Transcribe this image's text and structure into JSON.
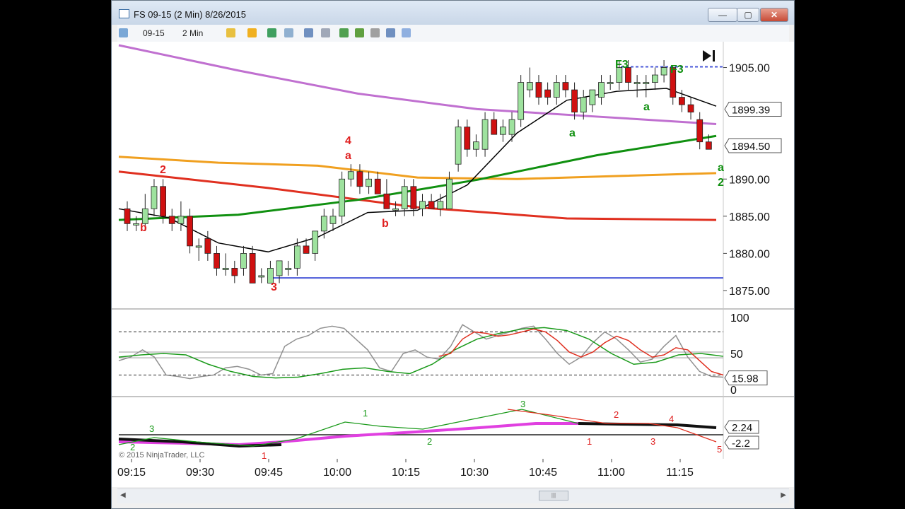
{
  "window": {
    "title": "FS 09-15 (2 Min)  8/26/2015",
    "buttons": {
      "minimize": "—",
      "maximize": "▢",
      "close": "✕"
    }
  },
  "toolbar": {
    "instrument": "09-15",
    "interval": "2 Min"
  },
  "icons": [
    "chart-app-icon",
    "bar-style-icon",
    "pencil-icon",
    "pen-tool-icon",
    "crosshair-icon",
    "zoom-icon",
    "properties-icon",
    "data-box-icon",
    "strategy-icon",
    "indicators-icon",
    "save-icon",
    "copy-icon"
  ],
  "copyright": "© 2015 NinjaTrader, LLC",
  "chart_data": {
    "type": "candlestick",
    "x_labels": [
      "09:15",
      "09:30",
      "09:45",
      "10:00",
      "10:15",
      "10:30",
      "10:45",
      "11:00",
      "11:15"
    ],
    "price_ticks": [
      "1905.00",
      "1890.00",
      "1885.00",
      "1880.00",
      "1875.00"
    ],
    "price_badges": [
      "1899.39",
      "1894.50"
    ],
    "ylim": [
      1873,
      1908
    ],
    "candles": [
      {
        "o": 1886,
        "h": 1887,
        "l": 1883,
        "c": 1884
      },
      {
        "o": 1884,
        "h": 1885,
        "l": 1883,
        "c": 1884
      },
      {
        "o": 1884,
        "h": 1888,
        "l": 1883,
        "c": 1886
      },
      {
        "o": 1886,
        "h": 1890,
        "l": 1885,
        "c": 1889
      },
      {
        "o": 1889,
        "h": 1890,
        "l": 1884,
        "c": 1885
      },
      {
        "o": 1885,
        "h": 1886,
        "l": 1883,
        "c": 1884
      },
      {
        "o": 1884,
        "h": 1887,
        "l": 1883,
        "c": 1885
      },
      {
        "o": 1885,
        "h": 1886,
        "l": 1880,
        "c": 1881
      },
      {
        "o": 1881,
        "h": 1882,
        "l": 1879,
        "c": 1881
      },
      {
        "o": 1882,
        "h": 1883,
        "l": 1879,
        "c": 1880
      },
      {
        "o": 1880,
        "h": 1881,
        "l": 1877,
        "c": 1878
      },
      {
        "o": 1878,
        "h": 1880,
        "l": 1877,
        "c": 1878
      },
      {
        "o": 1878,
        "h": 1879,
        "l": 1876,
        "c": 1877
      },
      {
        "o": 1878,
        "h": 1881,
        "l": 1877,
        "c": 1880
      },
      {
        "o": 1880,
        "h": 1881,
        "l": 1876,
        "c": 1876
      },
      {
        "o": 1877,
        "h": 1878,
        "l": 1876,
        "c": 1877
      },
      {
        "o": 1876,
        "h": 1879,
        "l": 1876,
        "c": 1878
      },
      {
        "o": 1877,
        "h": 1879,
        "l": 1876,
        "c": 1879
      },
      {
        "o": 1878,
        "h": 1879,
        "l": 1877,
        "c": 1878
      },
      {
        "o": 1878,
        "h": 1882,
        "l": 1877,
        "c": 1881
      },
      {
        "o": 1881,
        "h": 1882,
        "l": 1880,
        "c": 1880
      },
      {
        "o": 1880,
        "h": 1883,
        "l": 1879,
        "c": 1883
      },
      {
        "o": 1883,
        "h": 1886,
        "l": 1882,
        "c": 1885
      },
      {
        "o": 1884,
        "h": 1886,
        "l": 1883,
        "c": 1885
      },
      {
        "o": 1885,
        "h": 1891,
        "l": 1884,
        "c": 1890
      },
      {
        "o": 1890,
        "h": 1892,
        "l": 1889,
        "c": 1891
      },
      {
        "o": 1891,
        "h": 1892,
        "l": 1888,
        "c": 1889
      },
      {
        "o": 1889,
        "h": 1891,
        "l": 1888,
        "c": 1890
      },
      {
        "o": 1890,
        "h": 1891,
        "l": 1888,
        "c": 1888
      },
      {
        "o": 1888,
        "h": 1890,
        "l": 1886,
        "c": 1886
      },
      {
        "o": 1886,
        "h": 1887,
        "l": 1885,
        "c": 1886
      },
      {
        "o": 1886,
        "h": 1890,
        "l": 1885,
        "c": 1889
      },
      {
        "o": 1889,
        "h": 1890,
        "l": 1885,
        "c": 1886
      },
      {
        "o": 1886,
        "h": 1888,
        "l": 1885,
        "c": 1887
      },
      {
        "o": 1887,
        "h": 1888,
        "l": 1886,
        "c": 1886
      },
      {
        "o": 1886,
        "h": 1888,
        "l": 1885,
        "c": 1887
      },
      {
        "o": 1886,
        "h": 1891,
        "l": 1886,
        "c": 1890
      },
      {
        "o": 1892,
        "h": 1898,
        "l": 1891,
        "c": 1897
      },
      {
        "o": 1897,
        "h": 1898,
        "l": 1893,
        "c": 1894
      },
      {
        "o": 1894,
        "h": 1896,
        "l": 1893,
        "c": 1895
      },
      {
        "o": 1894,
        "h": 1899,
        "l": 1893,
        "c": 1898
      },
      {
        "o": 1898,
        "h": 1899,
        "l": 1896,
        "c": 1896
      },
      {
        "o": 1896,
        "h": 1898,
        "l": 1895,
        "c": 1897
      },
      {
        "o": 1896,
        "h": 1899,
        "l": 1895,
        "c": 1898
      },
      {
        "o": 1898,
        "h": 1904,
        "l": 1897,
        "c": 1903
      },
      {
        "o": 1902,
        "h": 1905,
        "l": 1901,
        "c": 1903
      },
      {
        "o": 1903,
        "h": 1904,
        "l": 1900,
        "c": 1901
      },
      {
        "o": 1902,
        "h": 1903,
        "l": 1900,
        "c": 1901
      },
      {
        "o": 1901,
        "h": 1904,
        "l": 1900,
        "c": 1903
      },
      {
        "o": 1903,
        "h": 1904,
        "l": 1901,
        "c": 1902
      },
      {
        "o": 1902,
        "h": 1903,
        "l": 1898,
        "c": 1899
      },
      {
        "o": 1899,
        "h": 1902,
        "l": 1898,
        "c": 1901
      },
      {
        "o": 1900,
        "h": 1902,
        "l": 1899,
        "c": 1902
      },
      {
        "o": 1901,
        "h": 1904,
        "l": 1900,
        "c": 1903
      },
      {
        "o": 1903,
        "h": 1904,
        "l": 1902,
        "c": 1903
      },
      {
        "o": 1903,
        "h": 1906,
        "l": 1902,
        "c": 1905
      },
      {
        "o": 1905,
        "h": 1906,
        "l": 1902,
        "c": 1903
      },
      {
        "o": 1903,
        "h": 1904,
        "l": 1901,
        "c": 1903
      },
      {
        "o": 1903,
        "h": 1904,
        "l": 1901,
        "c": 1903
      },
      {
        "o": 1903,
        "h": 1905,
        "l": 1902,
        "c": 1904
      },
      {
        "o": 1904,
        "h": 1906,
        "l": 1903,
        "c": 1905
      },
      {
        "o": 1905,
        "h": 1905,
        "l": 1900,
        "c": 1901
      },
      {
        "o": 1901,
        "h": 1902,
        "l": 1899,
        "c": 1900
      },
      {
        "o": 1900,
        "h": 1901,
        "l": 1898,
        "c": 1899
      },
      {
        "o": 1898,
        "h": 1899,
        "l": 1894,
        "c": 1895
      },
      {
        "o": 1895,
        "h": 1896,
        "l": 1894,
        "c": 1894
      }
    ],
    "series": [
      {
        "name": "",
        "color": "#c070d0",
        "values": [
          1908,
          1904.6,
          1901.5,
          1899.4,
          1898.4,
          1897.4
        ]
      },
      {
        "name": "",
        "color": "#f0a020",
        "values": [
          1893,
          1892.2,
          1891.8,
          1890.2,
          1890.0,
          1890.4,
          1890.8
        ]
      },
      {
        "name": "",
        "color": "#e03020",
        "values": [
          1891,
          1888.8,
          1886.2,
          1884.7,
          1884.5
        ]
      },
      {
        "name": "",
        "color": "#109010",
        "values": [
          1884.5,
          1885.2,
          1887.2,
          1889.9,
          1893.2,
          1895.8
        ]
      },
      {
        "name": "",
        "color": "#000000",
        "values": [
          1886,
          1884.8,
          1881.4,
          1880.2,
          1882.2,
          1885.5,
          1885.8,
          1889.2,
          1896.2,
          1900.6,
          1901.8,
          1902.2,
          1899.8
        ]
      }
    ],
    "labels": [
      {
        "text": "2",
        "color": "#e02020"
      },
      {
        "text": "3",
        "color": "#e02020"
      },
      {
        "text": "4",
        "color": "#e02020"
      },
      {
        "text": "F3",
        "color": "#109010"
      },
      {
        "text": "F3",
        "color": "#109010"
      },
      {
        "text": "2",
        "color": "#109010"
      },
      {
        "text": "a",
        "color": "#109010"
      },
      {
        "text": "a",
        "color": "#109010"
      },
      {
        "text": "a",
        "color": "#109010"
      },
      {
        "text": "a",
        "color": "#e02020"
      },
      {
        "text": "b",
        "color": "#e02020"
      },
      {
        "text": "b",
        "color": "#e02020"
      }
    ],
    "oscillator": {
      "ticks": [
        "100",
        "50",
        "0"
      ],
      "badge": "15.98",
      "ylim": [
        -10,
        110
      ],
      "overbought": 80,
      "oversold": 20,
      "fast": [
        40,
        45,
        55,
        45,
        20,
        18,
        15,
        18,
        20,
        30,
        32,
        28,
        20,
        22,
        60,
        70,
        75,
        85,
        88,
        85,
        70,
        55,
        30,
        25,
        50,
        55,
        45,
        42,
        60,
        90,
        80,
        70,
        75,
        80,
        85,
        88,
        70,
        50,
        35,
        45,
        65,
        80,
        70,
        55,
        38,
        42,
        60,
        75,
        45,
        25,
        18,
        17
      ],
      "slow": [
        45,
        48,
        50,
        48,
        35,
        25,
        18,
        16,
        17,
        22,
        28,
        30,
        25,
        22,
        35,
        55,
        70,
        78,
        84,
        86,
        82,
        70,
        50,
        35,
        38,
        48,
        50,
        46,
        50,
        70,
        80,
        78,
        74,
        76,
        80,
        84,
        80,
        68,
        52,
        45,
        52,
        65,
        74,
        68,
        55,
        45,
        48,
        58,
        55,
        40,
        25,
        20
      ]
    },
    "histogram": {
      "badges": [
        "2.24",
        "-2.2"
      ],
      "green_labels": [
        "2",
        "3",
        "1",
        "2",
        "3"
      ],
      "red_labels": [
        "1",
        "1",
        "2",
        "3",
        "4",
        "5"
      ]
    }
  }
}
